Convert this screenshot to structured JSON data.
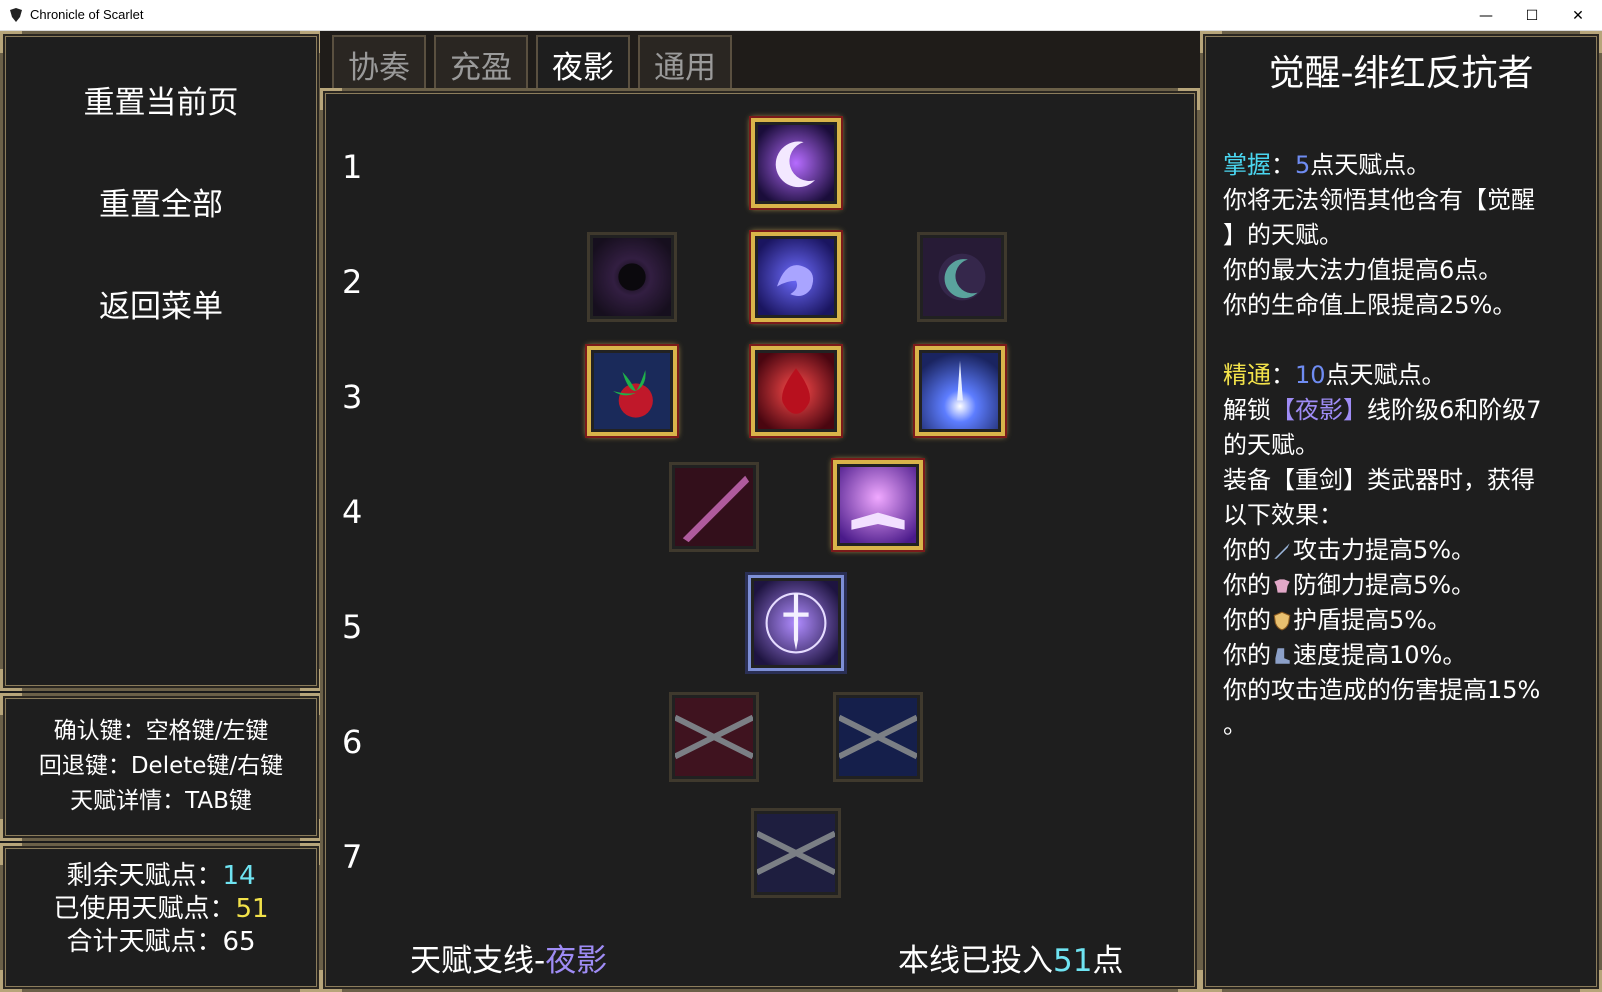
{
  "window": {
    "title": "Chronicle of Scarlet",
    "minimize_glyph": "—",
    "maximize_glyph": "☐",
    "close_glyph": "✕"
  },
  "menu": {
    "reset_page": "重置当前页",
    "reset_all": "重置全部",
    "back_to_menu": "返回菜单"
  },
  "help": {
    "confirm": "确认键：空格键/左键",
    "back": "回退键：Delete键/右键",
    "details": "天赋详情：TAB键"
  },
  "stats": {
    "remaining_label": "剩余天赋点：",
    "remaining_value": "14",
    "used_label": "已使用天赋点：",
    "used_value": "51",
    "total_label": "合计天赋点：",
    "total_value": "65"
  },
  "tabs": [
    {
      "label": "协奏"
    },
    {
      "label": "充盈"
    },
    {
      "label": "夜影",
      "active": true
    },
    {
      "label": "通用"
    }
  ],
  "rows": [
    "1",
    "2",
    "3",
    "4",
    "5",
    "6",
    "7"
  ],
  "branch": {
    "prefix": "天赋支线-",
    "name": "夜影",
    "invested_prefix": "本线已投入",
    "invested_value": "51",
    "invested_suffix": "点"
  },
  "detail": {
    "title": "觉醒-绯红反抗者",
    "mastery_label": "掌握",
    "mastery_colon": "：",
    "mastery_points": "5",
    "mastery_suffix": "点天赋点。",
    "mastery_line1": "你将无法领悟其他含有【觉醒",
    "mastery_line2": "】的天赋。",
    "mastery_line3": "你的最大法力值提高6点。",
    "mastery_line4": "你的生命值上限提高25%。",
    "expert_label": "精通",
    "expert_colon": "：",
    "expert_points": "10",
    "expert_suffix": "点天赋点。",
    "unlock_prefix": "解锁",
    "unlock_branch": "【夜影】",
    "unlock_suffix": "线阶级6和阶级7",
    "unlock_line2": "的天赋。",
    "equip_line1": "装备【重剑】类武器时，获得",
    "equip_line2": "以下效果：",
    "attack_prefix": "你的",
    "attack_text": "攻击力提高5%。",
    "defense_prefix": "你的",
    "defense_text": "防御力提高5%。",
    "shield_prefix": "你的",
    "shield_text": "护盾提高5%。",
    "speed_prefix": "你的",
    "speed_text": "速度提高10%。",
    "damage_line1": "你的攻击造成的伤害提高15%",
    "damage_line2": "。"
  },
  "colors": {
    "mastery": "#4ad6f0",
    "expert": "#f2e24a",
    "points": "#6f8cf2",
    "branch": "#9f8cf5",
    "frame_gold": "#d9b44a"
  }
}
